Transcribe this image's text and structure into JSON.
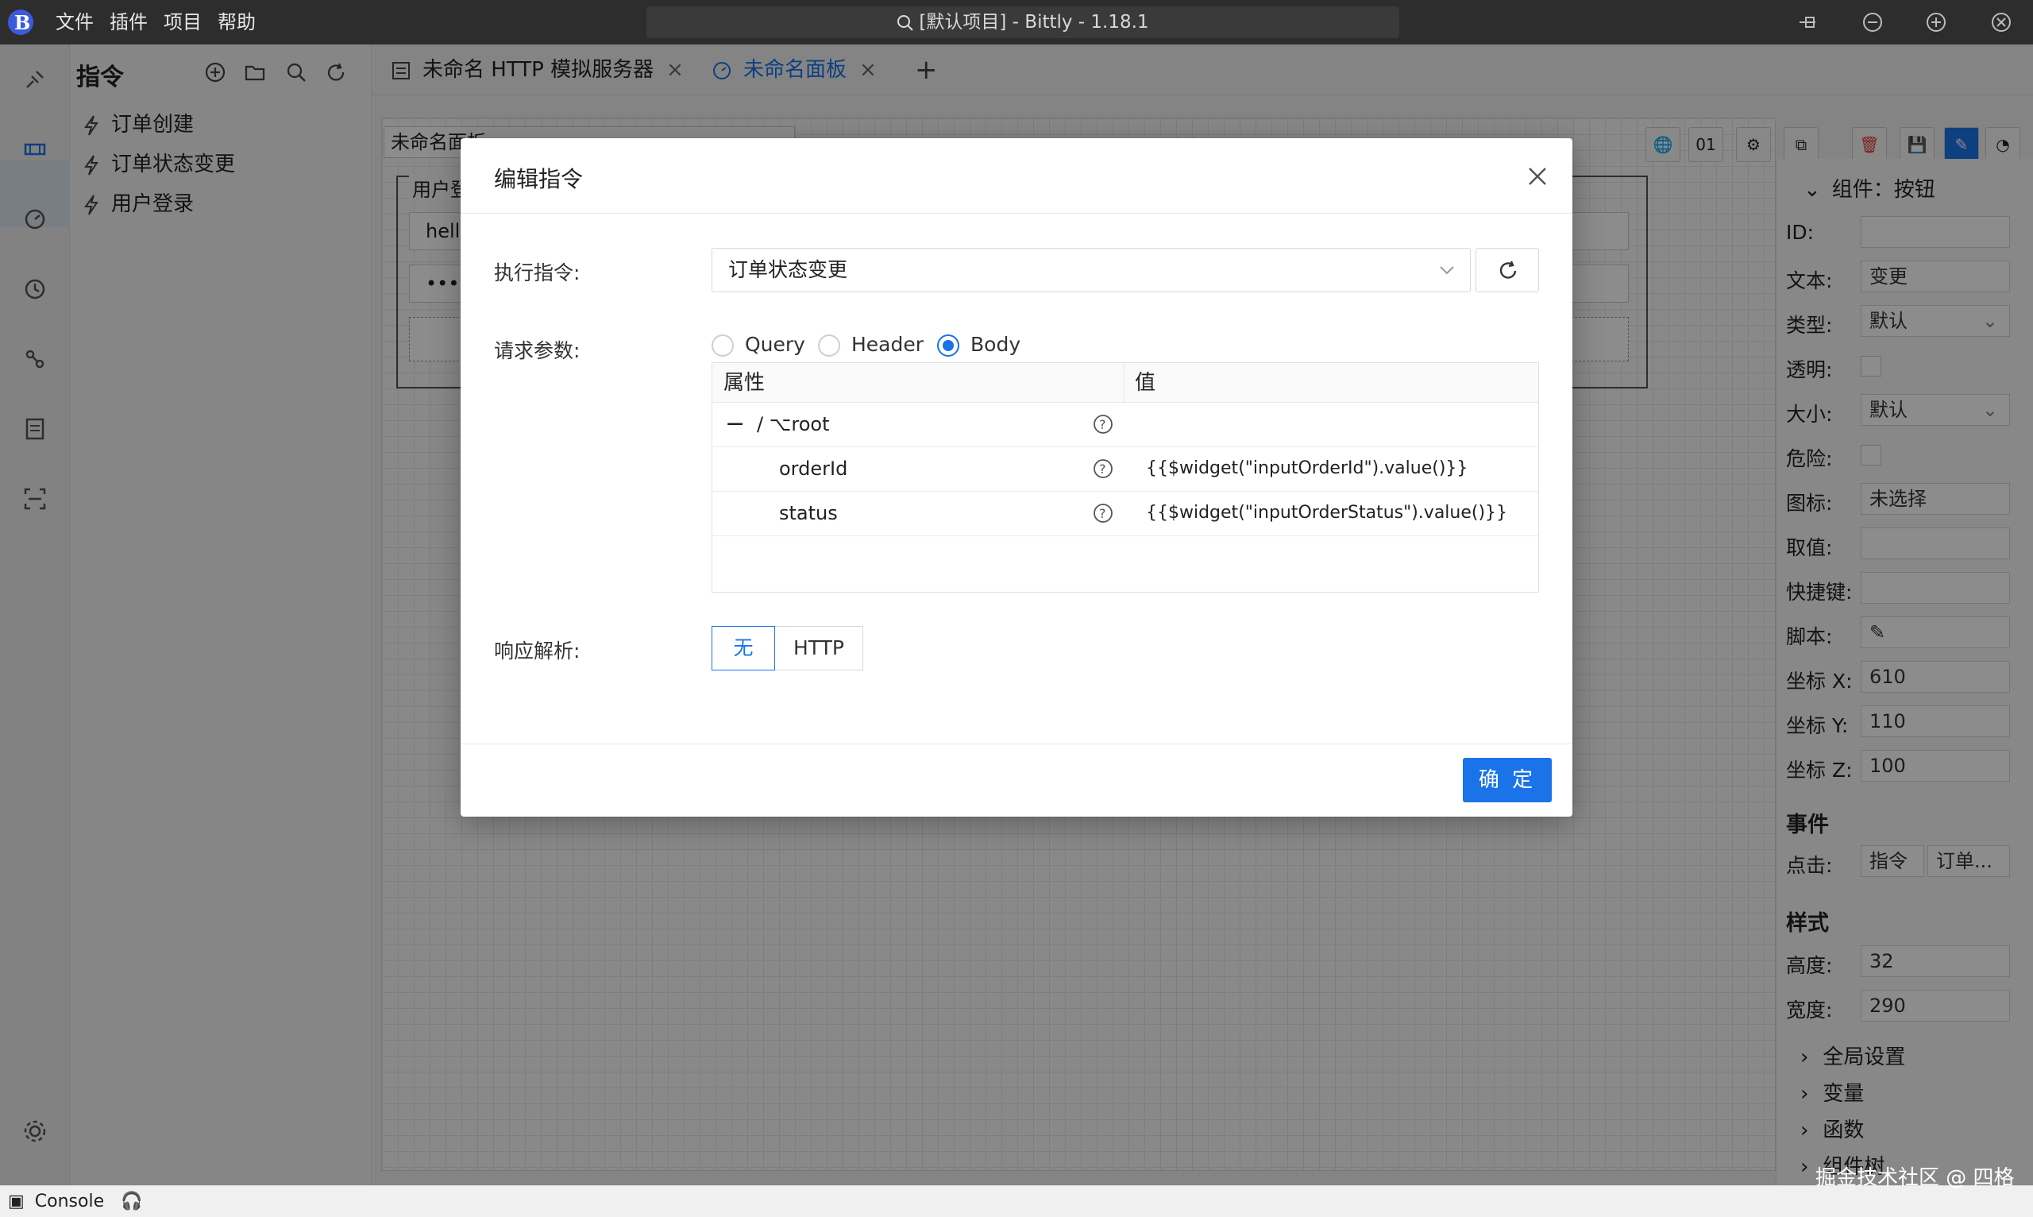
{
  "titlebar": {
    "menu": [
      "文件",
      "插件",
      "项目",
      "帮助"
    ],
    "window_title": "[默认项目] - Bittly - 1.18.1"
  },
  "sidebar": {
    "title": "指令",
    "items": [
      {
        "label": "订单创建"
      },
      {
        "label": "订单状态变更"
      },
      {
        "label": "用户登录"
      }
    ]
  },
  "tabs": [
    {
      "label": "未命名 HTTP 模拟服务器"
    },
    {
      "label": "未命名面板"
    }
  ],
  "canvas": {
    "panel_name_partial": "未命名面板",
    "group_title_partial": "用户登",
    "input_partial": "hello",
    "password_dots": "••••"
  },
  "toolbar": {
    "binary_label": "01"
  },
  "rightpanel": {
    "header": "组件：按钮",
    "fields": [
      {
        "label": "ID:",
        "value": ""
      },
      {
        "label": "文本:",
        "value": "变更"
      },
      {
        "label": "类型:",
        "value": "默认"
      },
      {
        "label": "透明:",
        "value": ""
      },
      {
        "label": "大小:",
        "value": "默认"
      },
      {
        "label": "危险:",
        "value": ""
      },
      {
        "label": "图标:",
        "value": "未选择"
      },
      {
        "label": "取值:",
        "value": ""
      },
      {
        "label": "快捷键:",
        "value": ""
      },
      {
        "label": "脚本:",
        "value": ""
      },
      {
        "label": "坐标 X:",
        "value": "610"
      },
      {
        "label": "坐标 Y:",
        "value": "110"
      },
      {
        "label": "坐标 Z:",
        "value": "100"
      }
    ],
    "events_title": "事件",
    "click_label": "点击:",
    "click_type": "指令",
    "click_target": "订单...",
    "style_title": "样式",
    "height_label": "高度:",
    "height_value": "32",
    "width_label": "宽度:",
    "width_value": "290",
    "tree": [
      "全局设置",
      "变量",
      "函数",
      "组件树"
    ]
  },
  "dialog": {
    "title": "编辑指令",
    "exec_label": "执行指令:",
    "exec_value": "订单状态变更",
    "params_label": "请求参数:",
    "param_types": [
      "Query",
      "Header",
      "Body"
    ],
    "param_type_selected": "Body",
    "table_headers": [
      "属性",
      "值"
    ],
    "root_label": "/ ⌥root",
    "rows": [
      {
        "name": "orderId",
        "value": "{{$widget(\"inputOrderId\").value()}}"
      },
      {
        "name": "status",
        "value": "{{$widget(\"inputOrderStatus\").value()}}"
      }
    ],
    "response_label": "响应解析:",
    "response_options": [
      "无",
      "HTTP"
    ],
    "response_selected": "无",
    "ok_label": "确 定"
  },
  "statusbar": {
    "console_label": "Console"
  },
  "watermark": "掘金技术社区 @ 四格",
  "colors": {
    "accent": "#1a73e8",
    "titlebar_bg": "#2d2d2d",
    "danger": "#e53935"
  }
}
